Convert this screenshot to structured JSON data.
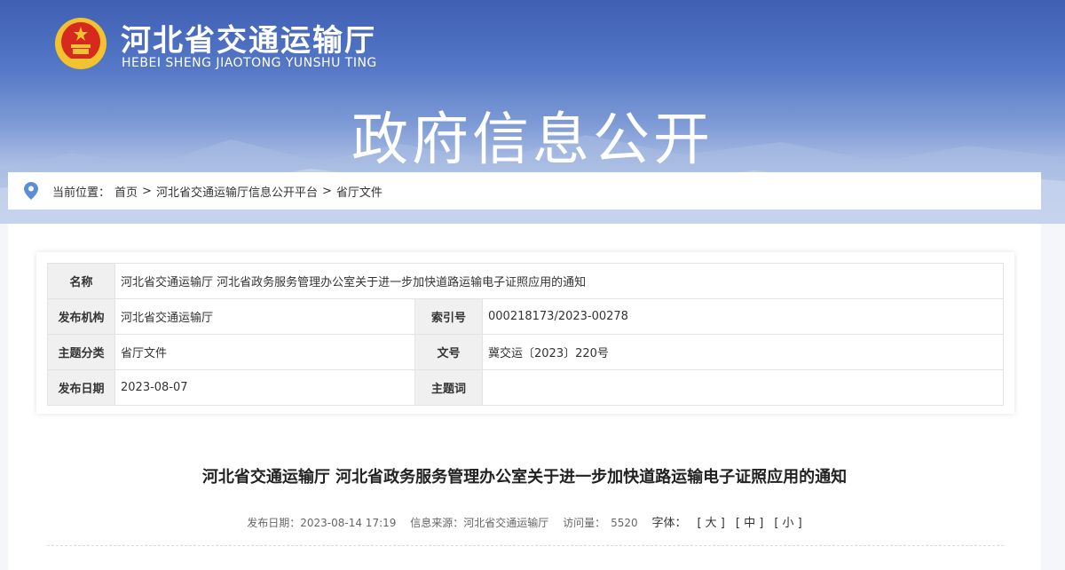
{
  "header": {
    "site_title_cn": "河北省交通运输厅",
    "site_title_en": "HEBEI SHENG JIAOTONG YUNSHU TING",
    "section_title": "政府信息公开"
  },
  "breadcrumb": {
    "prefix": "当前位置：",
    "items": [
      "首页",
      "河北省交通运输厅信息公开平台",
      "省厅文件"
    ],
    "separator": ">"
  },
  "meta_table": {
    "name_label": "名称",
    "name_value": "河北省交通运输厅 河北省政务服务管理办公室关于进一步加快道路运输电子证照应用的通知",
    "publisher_label": "发布机构",
    "publisher_value": "河北省交通运输厅",
    "index_label": "索引号",
    "index_value": "000218173/2023-00278",
    "category_label": "主题分类",
    "category_value": "省厅文件",
    "docno_label": "文号",
    "docno_value": "冀交运〔2023〕220号",
    "date_label": "发布日期",
    "date_value": "2023-08-07",
    "keywords_label": "主题词",
    "keywords_value": ""
  },
  "article": {
    "title": "河北省交通运输厅 河北省政务服务管理办公室关于进一步加快道路运输电子证照应用的通知",
    "publish_date": "发布日期：2023-08-14 17:19",
    "source": "信息来源：河北省交通运输厅",
    "visits_label": "访问量：",
    "visits_value": "5520",
    "font_label": "字体：",
    "font_large": "[ 大 ]",
    "font_medium": "[ 中 ]",
    "font_small": "[ 小 ]"
  },
  "colors": {
    "banner_top": "#3f5fb3",
    "banner_bottom": "#dfe6f3",
    "emblem_red": "#d62a1e",
    "emblem_gold": "#f2c230",
    "pin_blue": "#5a8ed8"
  },
  "icons": [
    "national-emblem-icon",
    "location-pin-icon"
  ]
}
